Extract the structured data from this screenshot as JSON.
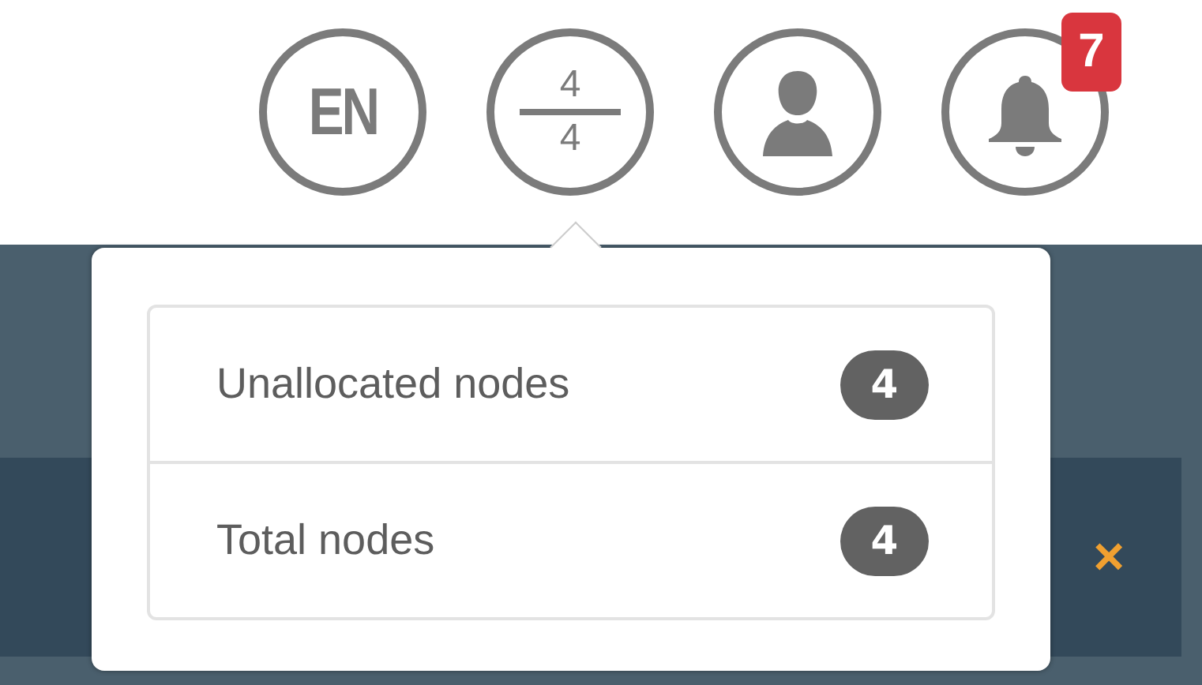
{
  "header": {
    "language": "EN",
    "nodes": {
      "numerator": "4",
      "denominator": "4"
    },
    "notifications": {
      "count": "7"
    }
  },
  "popover": {
    "rows": [
      {
        "label": "Unallocated nodes",
        "count": "4"
      },
      {
        "label": "Total nodes",
        "count": "4"
      }
    ]
  },
  "alert": {
    "close": "×"
  }
}
